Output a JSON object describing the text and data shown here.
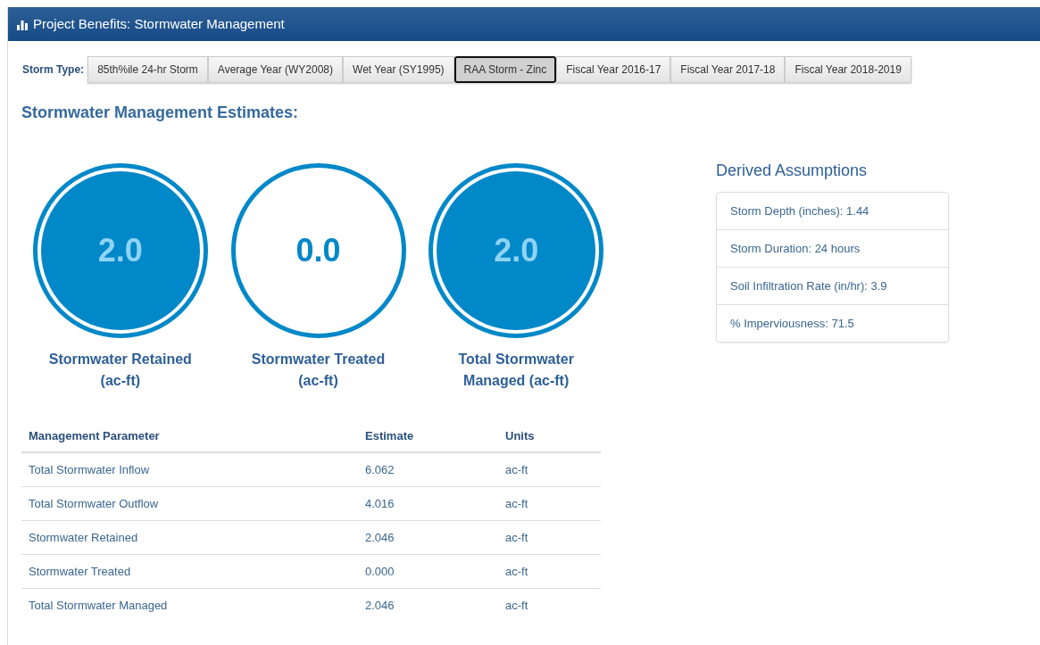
{
  "panel": {
    "title": "Project Benefits: Stormwater Management"
  },
  "storm_type": {
    "label": "Storm Type:",
    "options": [
      {
        "label": "85th%ile 24-hr Storm",
        "selected": false
      },
      {
        "label": "Average Year (WY2008)",
        "selected": false
      },
      {
        "label": "Wet Year (SY1995)",
        "selected": false
      },
      {
        "label": "RAA Storm - Zinc",
        "selected": true
      },
      {
        "label": "Fiscal Year 2016-17",
        "selected": false
      },
      {
        "label": "Fiscal Year 2017-18",
        "selected": false
      },
      {
        "label": "Fiscal Year 2018-2019",
        "selected": false
      }
    ]
  },
  "heading": "Stormwater Management Estimates:",
  "gauges": [
    {
      "value": "2.0",
      "label": "Stormwater Retained (ac-ft)",
      "filled": true
    },
    {
      "value": "0.0",
      "label": "Stormwater Treated (ac-ft)",
      "filled": false
    },
    {
      "value": "2.0",
      "label": "Total Stormwater Managed (ac-ft)",
      "filled": true
    }
  ],
  "table": {
    "columns": [
      "Management Parameter",
      "Estimate",
      "Units"
    ],
    "rows": [
      [
        "Total Stormwater Inflow",
        "6.062",
        "ac-ft"
      ],
      [
        "Total Stormwater Outflow",
        "4.016",
        "ac-ft"
      ],
      [
        "Stormwater Retained",
        "2.046",
        "ac-ft"
      ],
      [
        "Stormwater Treated",
        "0.000",
        "ac-ft"
      ],
      [
        "Total Stormwater Managed",
        "2.046",
        "ac-ft"
      ]
    ]
  },
  "assumptions": {
    "title": "Derived Assumptions",
    "items": [
      "Storm Depth (inches): 1.44",
      "Storm Duration: 24 hours",
      "Soil Infiltration Rate (in/hr): 3.9",
      "% Imperviousness: 71.5"
    ]
  }
}
